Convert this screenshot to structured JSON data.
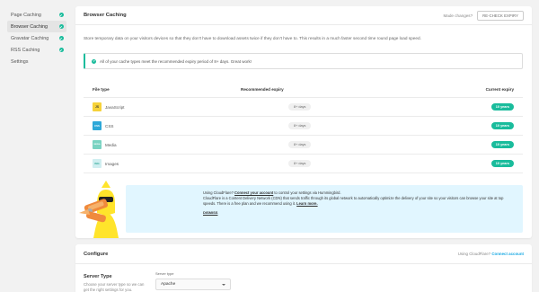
{
  "sidebar": {
    "items": [
      {
        "label": "Page Caching",
        "checked": true,
        "active": false
      },
      {
        "label": "Browser Caching",
        "checked": true,
        "active": true
      },
      {
        "label": "Gravatar Caching",
        "checked": true,
        "active": false
      },
      {
        "label": "RSS Caching",
        "checked": true,
        "active": false
      },
      {
        "label": "Settings",
        "checked": false,
        "active": false
      }
    ]
  },
  "main": {
    "title": "Browser Caching",
    "made_changes": "Made changes?",
    "recheck_label": "RE-CHECK EXPIRY",
    "description": "Store temporary data on your visitors devices so that they don't have to download assets twice if they don't have to. This results in a much faster second time round page load speed.",
    "notice": "All of your cache types meet the recommended expiry period of 8+ days. Great work!",
    "table": {
      "headers": {
        "file_type": "File type",
        "recommended": "Recommended expiry",
        "current": "Current expiry"
      },
      "rows": [
        {
          "name": "JavaScript",
          "icon": "javascript-icon",
          "icon_text": "JS",
          "icon_color": "#f6d23a",
          "recommended": "8+ days",
          "current": "10 years"
        },
        {
          "name": "CSS",
          "icon": "css-icon",
          "icon_text": "CSS",
          "icon_color": "#2ea8d8",
          "recommended": "8+ days",
          "current": "10 years"
        },
        {
          "name": "Media",
          "icon": "media-icon",
          "icon_text": "MEDIA",
          "icon_color": "#7ad3c2",
          "recommended": "8+ days",
          "current": "10 years"
        },
        {
          "name": "Images",
          "icon": "images-icon",
          "icon_text": "IMG",
          "icon_color": "#cfeef0",
          "recommended": "8+ days",
          "current": "10 years"
        }
      ]
    },
    "cloudflare": {
      "line1_prefix": "Using CloudFlare? ",
      "line1_link": "Connect your account",
      "line1_suffix": " to control your settings via Hummingbird.",
      "line2": "CloudFlare is a Content Delivery Network (CDN) that sends traffic through its global network to automatically optimize the delivery of your site so your visitors can browse your site at top speeds. There is a free plan and we recommend using it.",
      "learn_more": "Learn more.",
      "dismiss": "DISMISS"
    }
  },
  "configure": {
    "title": "Configure",
    "using_cf": "Using CloudFlare?",
    "connect": "Connect account",
    "server_type_title": "Server Type",
    "server_type_desc": "Choose your server type so we can get the right settings for you.",
    "server_label": "Server type",
    "server_value": "Apache"
  },
  "colors": {
    "accent": "#1abc9c",
    "link": "#17a8e3",
    "promo_bg": "#e1f6ff"
  }
}
